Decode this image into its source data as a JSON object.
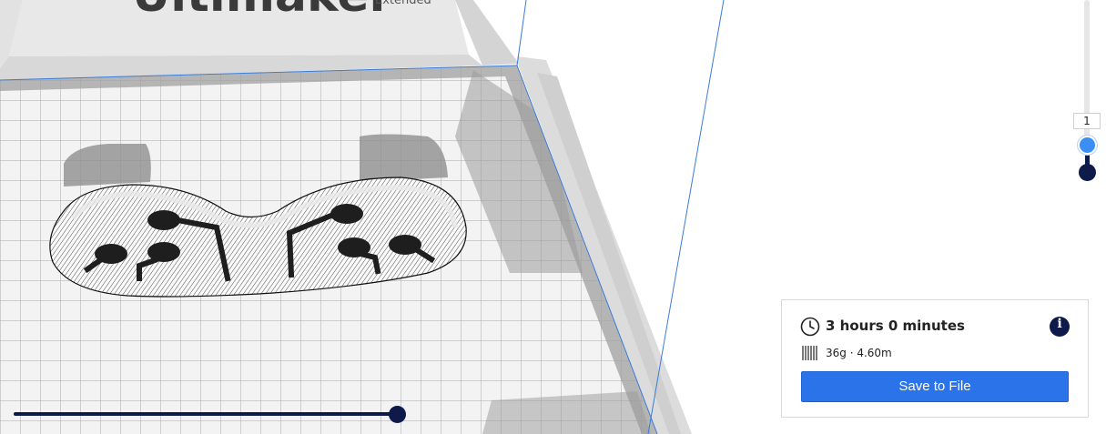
{
  "scene": {
    "printer_brand_text": "Ultimaker",
    "printer_model_text": "Extended"
  },
  "layer_slider": {
    "current_layer": "1",
    "handle_top_color": "#3a8ef6",
    "handle_bottom_color": "#0d1a4a"
  },
  "path_slider": {
    "position": 1.0,
    "color": "#0d1a4a"
  },
  "print_panel": {
    "time": "3 hours 0 minutes",
    "material": "36g · 4.60m",
    "save_label": "Save to File",
    "info_glyph": "i",
    "icons": {
      "time": "clock-icon",
      "material": "filament-spool-icon",
      "info": "info-icon"
    },
    "accent_color": "#2a73e8"
  }
}
